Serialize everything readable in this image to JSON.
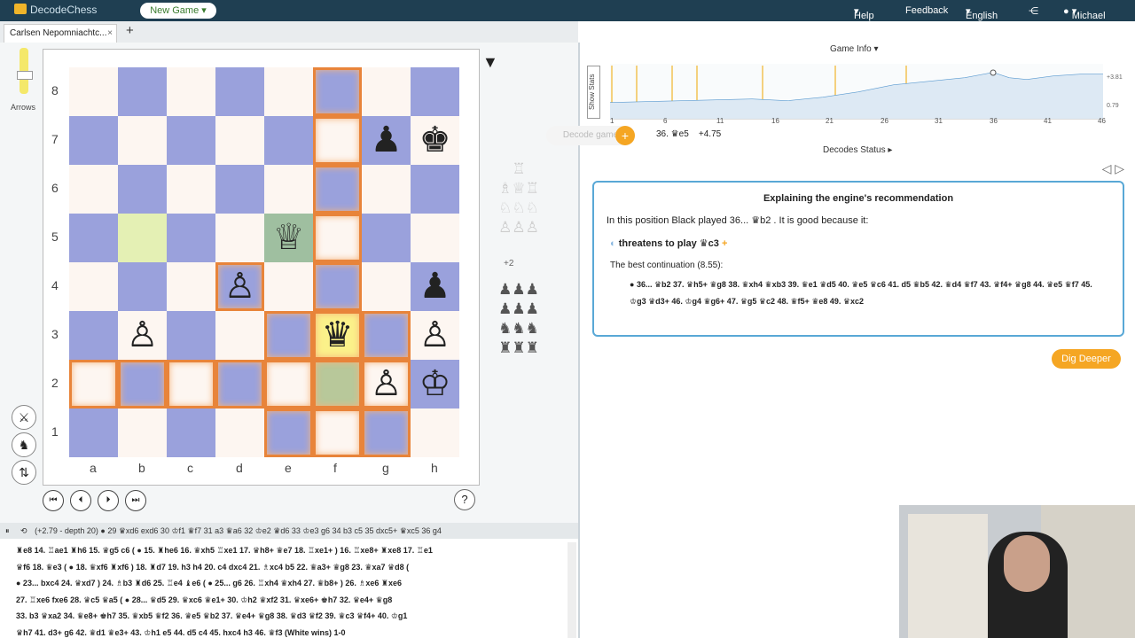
{
  "header": {
    "logo_text": "DecodeChess",
    "new_game": "New Game",
    "help": "Help",
    "feedback": "Feedback",
    "language": "English",
    "user": "Michael"
  },
  "tab": {
    "title": "Carlsen Nepomniachtc...",
    "close": "×",
    "add": "+"
  },
  "side": {
    "arrows": "Arrows"
  },
  "board": {
    "ranks": [
      "8",
      "7",
      "6",
      "5",
      "4",
      "3",
      "2",
      "1"
    ],
    "files": [
      "a",
      "b",
      "c",
      "d",
      "e",
      "f",
      "g",
      "h"
    ],
    "pieces": [
      {
        "sq": "g7",
        "glyph": "♟"
      },
      {
        "sq": "h7",
        "glyph": "♚"
      },
      {
        "sq": "e5",
        "glyph": "♕"
      },
      {
        "sq": "d4",
        "glyph": "♙"
      },
      {
        "sq": "h4",
        "glyph": "♟"
      },
      {
        "sq": "b3",
        "glyph": "♙"
      },
      {
        "sq": "f3",
        "glyph": "♛"
      },
      {
        "sq": "h3",
        "glyph": "♙"
      },
      {
        "sq": "g2",
        "glyph": "♙"
      },
      {
        "sq": "h2",
        "glyph": "♔"
      }
    ]
  },
  "nav": {
    "first": "⏮",
    "prev": "⏴",
    "next": "⏵",
    "last": "⏭",
    "help": "?"
  },
  "captured": {
    "plus2": "+2"
  },
  "right": {
    "game_info": "Game Info ▾",
    "show_stats": "Show Stats",
    "graph_top": "+3.81",
    "graph_bottom": "0.79",
    "graph_ticks": [
      "1",
      "6",
      "11",
      "16",
      "21",
      "26",
      "31",
      "36",
      "41",
      "46"
    ],
    "decode_game": "Decode game",
    "eval_move": "36. ♛e5",
    "eval_value": "+4.75",
    "decodes_status": "Decodes Status ▸",
    "explain_title": "Explaining the engine's recommendation",
    "explain_line1": "In this position Black played 36... ♛b2 . It is good because it:",
    "explain_threat": "threatens to play ♛c3",
    "best_cont": "The best continuation (8.55):",
    "best_line": "36... ♛b2 37. ♛h5+ ♛g8 38. ♛xh4 ♛xb3 39. ♛e1 ♛d5 40. ♛e5 ♛c6 41. d5 ♛b5 42. ♛d4 ♛f7 43. ♛f4+ ♛g8 44. ♛e5 ♛f7 45. ♔g3 ♛d3+ 46. ♔g4 ♛g6+ 47. ♛g5 ♛c2 48. ♛f5+ ♛e8 49. ♛xc2",
    "dig_deeper": "Dig Deeper"
  },
  "engine_line": "(+2.79 - depth 20) ● 29 ♛xd6 exd6 30 ♔f1 ♛f7 31 a3 ♛a6 32 ♔e2 ♛d6 33 ♔e3 g6 34 b3 c5 35 dxc5+ ♛xc5 36 g4",
  "moves": [
    "♜e8 14. ♖ae1 ♜h6 15. ♛g5 c6 ( ● 15. ♜he6 16. ♛xh5 ♖xe1 17. ♛h8+ ♛e7 18. ♖xe1+ ) 16. ♖xe8+ ♜xe8 17. ♖e1",
    "♛f6 18. ♛e3 ( ● 18. ♛xf6 ♜xf6 ) 18. ♜d7 19. h3 h4 20. c4 dxc4 21. ♗xc4 b5 22. ♛a3+ ♛g8 23. ♛xa7 ♛d8 (",
    "● 23... bxc4 24. ♛xd7 ) 24. ♗b3 ♜d6 25. ♖e4 ♝e6 ( ● 25... g6 26. ♖xh4 ♛xh4 27. ♛b8+ ) 26. ♗xe6 ♜xe6",
    "27. ♖xe6 fxe6 28. ♛c5 ♛a5 ( ● 28... ♛d5 29. ♛xc6 ♛e1+ 30. ♔h2 ♛xf2 31. ♛xe6+ ♚h7 32. ♛e4+ ♛g8",
    "33. b3 ♛xa2 34. ♛e8+ ♚h7 35. ♛xb5 ♛f2 36. ♛e5 ♛b2 37. ♛e4+ ♛g8 38. ♛d3 ♛f2 39. ♛c3 ♛f4+ 40. ♔g1",
    "♛h7 41. d3+ g6 42. ♛d1 ♛e3+ 43. ♔h1 e5 44. d5 c4 45. hxc4 h3 46. ♛f3 (White wins) 1-0"
  ]
}
